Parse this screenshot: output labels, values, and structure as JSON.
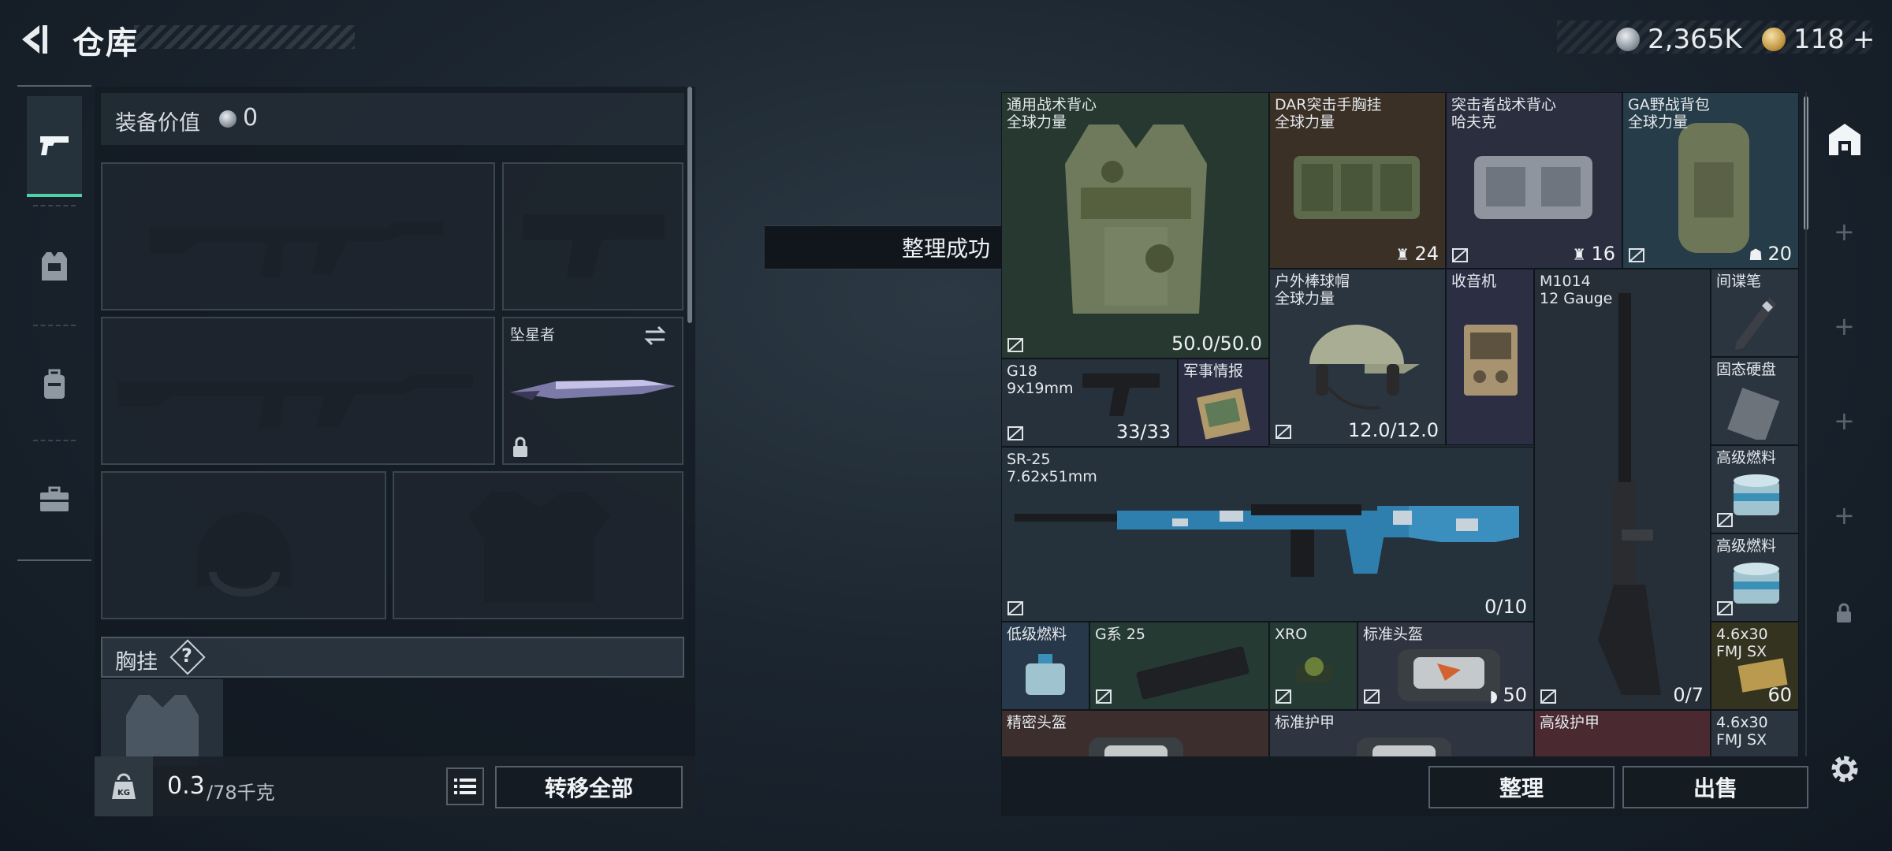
{
  "header": {
    "title": "仓库",
    "currency_1": "2,365K",
    "currency_2": "118",
    "currency_2_plus": "+",
    "accent_color": "#4fd1a6"
  },
  "tabs": [
    {
      "name": "firearms",
      "icon": "pistol-icon",
      "active": true
    },
    {
      "name": "armor",
      "icon": "armor-vest-icon",
      "active": false
    },
    {
      "name": "backpack",
      "icon": "backpack-icon",
      "active": false
    },
    {
      "name": "case",
      "icon": "briefcase-icon",
      "active": false
    }
  ],
  "loadout": {
    "equip_value_label": "装备价值",
    "equip_value": "0",
    "melee_label": "坠星者",
    "chest_label": "胸挂",
    "chest_help": "?"
  },
  "weight": {
    "current": "0.3",
    "max": "/78千克"
  },
  "buttons": {
    "transfer_all": "转移全部",
    "organize": "整理",
    "sell": "出售"
  },
  "toast": "整理成功",
  "stash_items": [
    {
      "id": "vest1",
      "name": "通用战术背心",
      "sub": "全球力量",
      "value": "50.0/50.0"
    },
    {
      "id": "dar",
      "name": "DAR突击手胸挂",
      "sub": "全球力量",
      "value": "24"
    },
    {
      "id": "assault",
      "name": "突击者战术背心",
      "sub": "哈夫克",
      "value": "16"
    },
    {
      "id": "ga",
      "name": "GA野战背包",
      "sub": "全球力量",
      "value": "20"
    },
    {
      "id": "cap",
      "name": "户外棒球帽",
      "sub": "全球力量",
      "value": "12.0/12.0"
    },
    {
      "id": "radio",
      "name": "收音机",
      "sub": "",
      "value": ""
    },
    {
      "id": "m1014",
      "name": "M1014",
      "sub": "12 Gauge",
      "value": "0/7"
    },
    {
      "id": "spypen",
      "name": "间谍笔",
      "sub": "",
      "value": ""
    },
    {
      "id": "g18",
      "name": "G18",
      "sub": "9x19mm",
      "value": "33/33"
    },
    {
      "id": "intel",
      "name": "军事情报",
      "sub": "",
      "value": ""
    },
    {
      "id": "ssd",
      "name": "固态硬盘",
      "sub": "",
      "value": ""
    },
    {
      "id": "sr25",
      "name": "SR-25",
      "sub": "7.62x51mm",
      "value": "0/10"
    },
    {
      "id": "fuel1",
      "name": "高级燃料",
      "sub": "",
      "value": ""
    },
    {
      "id": "fuel2",
      "name": "高级燃料",
      "sub": "",
      "value": ""
    },
    {
      "id": "lowfuel",
      "name": "低级燃料",
      "sub": "",
      "value": ""
    },
    {
      "id": "g25",
      "name": "G系 25",
      "sub": "",
      "value": ""
    },
    {
      "id": "xro",
      "name": "XRO",
      "sub": "",
      "value": ""
    },
    {
      "id": "helmet",
      "name": "标准头盔",
      "sub": "",
      "value": "50"
    },
    {
      "id": "ammo1",
      "name": "4.6x30",
      "sub": "FMJ SX",
      "value": "60"
    },
    {
      "id": "prechelmet",
      "name": "精密头盔",
      "sub": "",
      "value": ""
    },
    {
      "id": "stdarmor",
      "name": "标准护甲",
      "sub": "",
      "value": ""
    },
    {
      "id": "advarmor",
      "name": "高级护甲",
      "sub": "",
      "value": ""
    },
    {
      "id": "ammo2",
      "name": "4.6x30",
      "sub": "FMJ SX",
      "value": ""
    }
  ]
}
